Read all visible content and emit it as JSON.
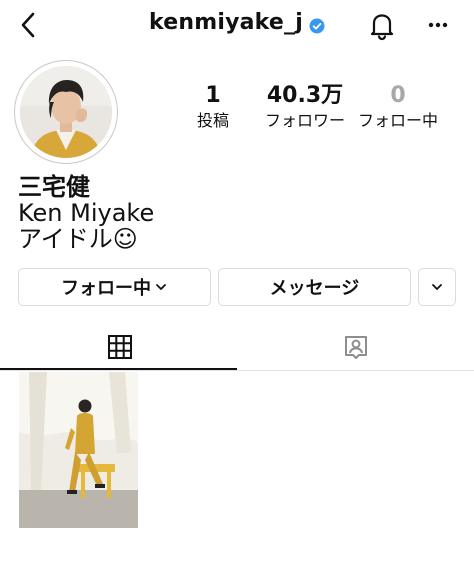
{
  "header": {
    "username": "kenmiyake_j",
    "back_icon": "chevron-left-icon",
    "verified_icon": "verified-badge-icon",
    "bell_icon": "bell-icon",
    "more_icon": "more-horizontal-icon",
    "verified_color": "#3897f0"
  },
  "profile": {
    "avatar_icon": "profile-photo",
    "stats": [
      {
        "value": "1",
        "label": "投稿"
      },
      {
        "value": "40.3万",
        "label": "フォロワー"
      },
      {
        "value": "0",
        "label": "フォロー中"
      }
    ],
    "bio": {
      "line1": "三宅健",
      "line2": "Ken Miyake",
      "line3": "アイドル☺"
    }
  },
  "actions": {
    "following_label": "フォロー中",
    "following_chevron": "chevron-down-icon",
    "message_label": "メッセージ",
    "suggest_icon": "chevron-down-icon"
  },
  "tabs": {
    "grid_icon": "grid-icon",
    "tagged_icon": "tagged-person-icon",
    "active": "grid"
  },
  "posts": [
    {
      "type": "photo",
      "accent_color": "#d9a93a"
    }
  ]
}
